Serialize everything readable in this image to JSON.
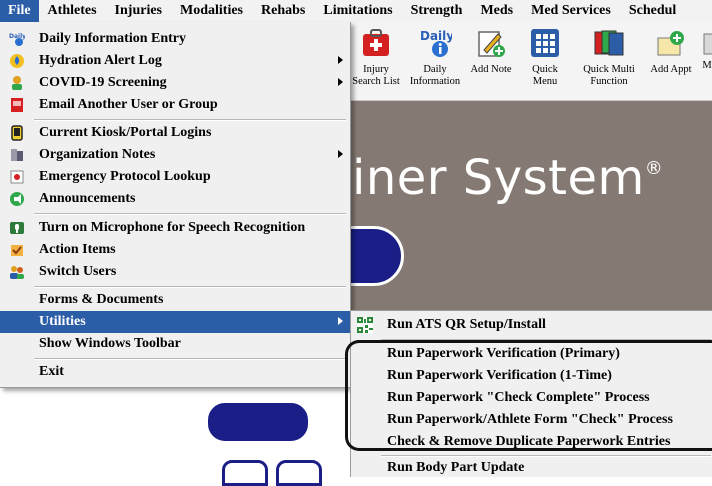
{
  "menubar": {
    "items": [
      "File",
      "Athletes",
      "Injuries",
      "Modalities",
      "Rehabs",
      "Limitations",
      "Strength",
      "Meds",
      "Med Services",
      "Schedul"
    ],
    "active_index": 0
  },
  "toolbar": {
    "injury_search": "Injury\nSearch List",
    "daily_info": "Daily\nInformation",
    "daily_icon_text": "Daily",
    "add_note": "Add Note",
    "quick_menu": "Quick\nMenu",
    "quick_multi": "Quick Multi\nFunction",
    "add_appt": "Add Appt",
    "more": "M"
  },
  "background": {
    "title": "iner System",
    "reg_mark": "®",
    "bg_color": "#857a73",
    "oval_color": "#1a1e86"
  },
  "file_menu": {
    "items": [
      {
        "label": "Daily Information Entry",
        "icon": "daily-info-icon",
        "submenu": false
      },
      {
        "label": "Hydration Alert Log",
        "icon": "hydration-icon",
        "submenu": true
      },
      {
        "label": "COVID-19 Screening",
        "icon": "covid-icon",
        "submenu": true
      },
      {
        "label": "Email Another User or Group",
        "icon": "email-icon",
        "submenu": false
      },
      {
        "label": "Current Kiosk/Portal Logins",
        "icon": "kiosk-icon",
        "submenu": false
      },
      {
        "label": "Organization Notes",
        "icon": "notes-icon",
        "submenu": true
      },
      {
        "label": "Emergency Protocol Lookup",
        "icon": "emergency-icon",
        "submenu": false
      },
      {
        "label": "Announcements",
        "icon": "announcement-icon",
        "submenu": false
      },
      {
        "label": "Turn on Microphone for Speech Recognition",
        "icon": "microphone-icon",
        "submenu": false
      },
      {
        "label": "Action Items",
        "icon": "action-items-icon",
        "submenu": false
      },
      {
        "label": "Switch Users",
        "icon": "switch-users-icon",
        "submenu": false
      },
      {
        "label": "Forms & Documents",
        "icon": "",
        "submenu": false
      },
      {
        "label": "Utilities",
        "icon": "",
        "submenu": true,
        "selected": true
      },
      {
        "label": "Show Windows Toolbar",
        "icon": "",
        "submenu": false
      },
      {
        "label": "Exit",
        "icon": "",
        "submenu": false
      }
    ]
  },
  "utilities_submenu": {
    "items": [
      {
        "label": "Run ATS QR Setup/Install",
        "icon": "qr-code-icon"
      },
      {
        "label": "Run Paperwork Verification (Primary)"
      },
      {
        "label": "Run Paperwork Verification (1-Time)"
      },
      {
        "label": "Run Paperwork \"Check Complete\" Process"
      },
      {
        "label": "Run Paperwork/Athlete Form \"Check\" Process"
      },
      {
        "label": "Check & Remove Duplicate Paperwork Entries"
      },
      {
        "label": "Run Body Part Update"
      }
    ]
  },
  "colors": {
    "selection": "#2c5ea8",
    "menu_bg": "#f0f0f0"
  }
}
